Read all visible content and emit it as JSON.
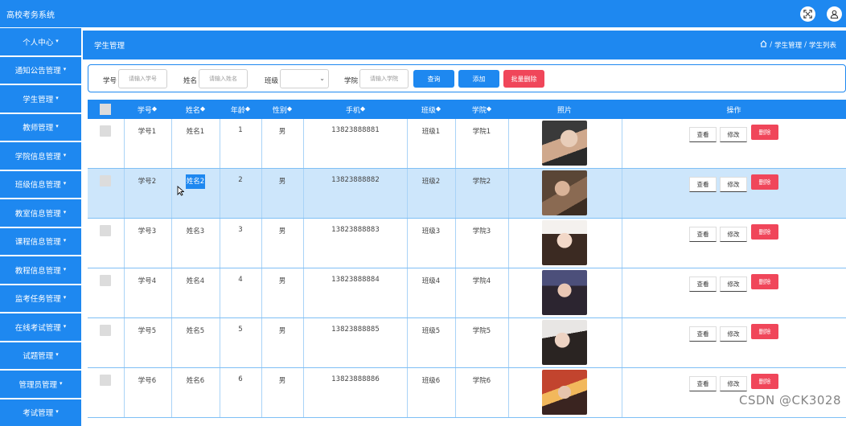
{
  "app": {
    "title": "高校考务系统"
  },
  "header_icons": [
    "fullscreen-icon",
    "user-icon"
  ],
  "sidebar": {
    "items": [
      {
        "label": "个人中心"
      },
      {
        "label": "通知公告管理"
      },
      {
        "label": "学生管理"
      },
      {
        "label": "教师管理"
      },
      {
        "label": "学院信息管理"
      },
      {
        "label": "班级信息管理"
      },
      {
        "label": "教室信息管理"
      },
      {
        "label": "课程信息管理"
      },
      {
        "label": "教程信息管理"
      },
      {
        "label": "监考任务管理"
      },
      {
        "label": "在线考试管理"
      },
      {
        "label": "试题管理"
      },
      {
        "label": "管理员管理"
      },
      {
        "label": "考试管理"
      }
    ]
  },
  "page": {
    "title": "学生管理",
    "breadcrumb": [
      "学生管理",
      "学生列表"
    ]
  },
  "search": {
    "student_no_label": "学号",
    "student_no_placeholder": "请输入学号",
    "name_label": "姓名",
    "name_placeholder": "请输入姓名",
    "class_label": "班级",
    "college_label": "学院",
    "college_placeholder": "请输入学院",
    "query_btn": "查询",
    "add_btn": "添加",
    "batch_delete_btn": "批量删除"
  },
  "table": {
    "headers": {
      "student_no": "学号",
      "name": "姓名",
      "age": "年龄",
      "gender": "性别",
      "phone": "手机",
      "class": "班级",
      "college": "学院",
      "photo": "照片",
      "actions": "操作"
    },
    "sort_icon": "sort-icon",
    "rows": [
      {
        "student_no": "学号1",
        "name": "姓名1",
        "age": "1",
        "gender": "男",
        "phone": "13823888881",
        "class": "班级1",
        "college": "学院1"
      },
      {
        "student_no": "学号2",
        "name": "姓名2",
        "age": "2",
        "gender": "男",
        "phone": "13823888882",
        "class": "班级2",
        "college": "学院2"
      },
      {
        "student_no": "学号3",
        "name": "姓名3",
        "age": "3",
        "gender": "男",
        "phone": "13823888883",
        "class": "班级3",
        "college": "学院3"
      },
      {
        "student_no": "学号4",
        "name": "姓名4",
        "age": "4",
        "gender": "男",
        "phone": "13823888884",
        "class": "班级4",
        "college": "学院4"
      },
      {
        "student_no": "学号5",
        "name": "姓名5",
        "age": "5",
        "gender": "男",
        "phone": "13823888885",
        "class": "班级5",
        "college": "学院5"
      },
      {
        "student_no": "学号6",
        "name": "姓名6",
        "age": "6",
        "gender": "男",
        "phone": "13823888886",
        "class": "班级6",
        "college": "学院6"
      }
    ],
    "actions": {
      "view": "查看",
      "edit": "修改",
      "delete": "删除"
    }
  },
  "watermark": "CSDN @CK3028",
  "colors": {
    "primary": "#1e88f0",
    "danger": "#f0465a",
    "selected_row": "#cde6fb"
  }
}
